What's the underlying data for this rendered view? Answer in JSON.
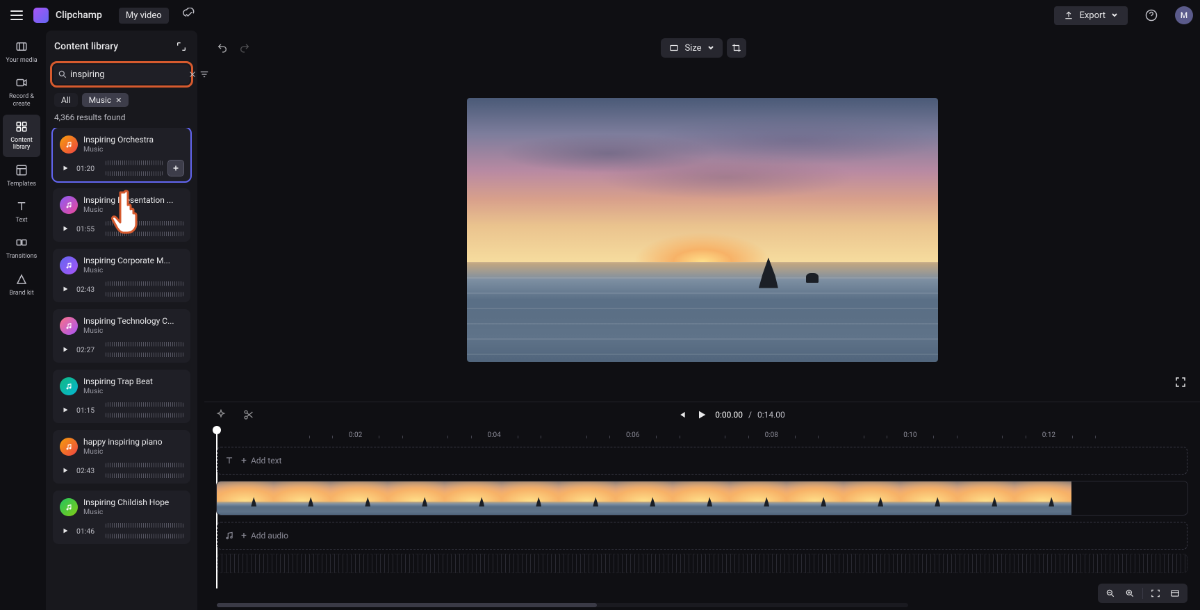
{
  "brand": "Clipchamp",
  "project_title": "My video",
  "export_label": "Export",
  "avatar_initial": "M",
  "rail": [
    {
      "id": "your-media",
      "label": "Your media"
    },
    {
      "id": "record-create",
      "label": "Record & create"
    },
    {
      "id": "content-library",
      "label": "Content library"
    },
    {
      "id": "templates",
      "label": "Templates"
    },
    {
      "id": "text",
      "label": "Text"
    },
    {
      "id": "transitions",
      "label": "Transitions"
    },
    {
      "id": "brand-kit",
      "label": "Brand kit"
    }
  ],
  "panel_title": "Content library",
  "search": {
    "value": "inspiring"
  },
  "chips": {
    "all": "All",
    "active": "Music"
  },
  "results_count": "4,366 results found",
  "tracks": [
    {
      "title": "Inspiring Orchestra",
      "subtitle": "Music",
      "duration": "01:20",
      "grad": "g-orange",
      "selected": true
    },
    {
      "title": "Inspiring Presentation ...",
      "subtitle": "Music",
      "duration": "01:55",
      "grad": "g-purple"
    },
    {
      "title": "Inspiring Corporate M...",
      "subtitle": "Music",
      "duration": "02:43",
      "grad": "g-blue"
    },
    {
      "title": "Inspiring Technology C...",
      "subtitle": "Music",
      "duration": "02:27",
      "grad": "g-coral"
    },
    {
      "title": "Inspiring Trap Beat",
      "subtitle": "Music",
      "duration": "01:15",
      "grad": "g-teal"
    },
    {
      "title": "happy inspiring piano",
      "subtitle": "Music",
      "duration": "02:43",
      "grad": "g-orange"
    },
    {
      "title": "Inspiring Childish Hope",
      "subtitle": "Music",
      "duration": "01:46",
      "grad": "g-green"
    }
  ],
  "size_label": "Size",
  "time": {
    "current": "0:00.00",
    "sep": "/",
    "total": "0:14.00"
  },
  "ruler": [
    "0:02",
    "0:04",
    "0:06",
    "0:08",
    "0:10",
    "0:12"
  ],
  "ghost_text_track": "Add text",
  "ghost_audio_track": "Add audio"
}
